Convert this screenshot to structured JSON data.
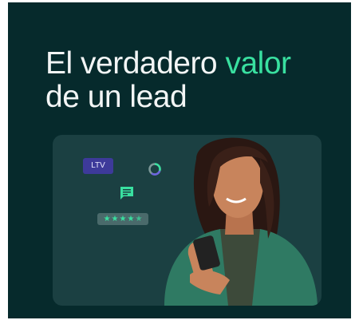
{
  "headline": {
    "line1_prefix": "El verdadero ",
    "line1_accent": "valor",
    "line2": "de un lead"
  },
  "badges": {
    "ltv_label": "LTV",
    "rating_value": 4.5,
    "rating_max": 5
  },
  "icons": {
    "ring": "progress-ring-icon",
    "chat": "chat-icon",
    "star": "star-icon"
  },
  "colors": {
    "background": "#062a2c",
    "card": "#1b4042",
    "accent": "#39e0a0",
    "ltv_badge": "#3d3a9a",
    "headline_text": "#f2f5f5"
  }
}
